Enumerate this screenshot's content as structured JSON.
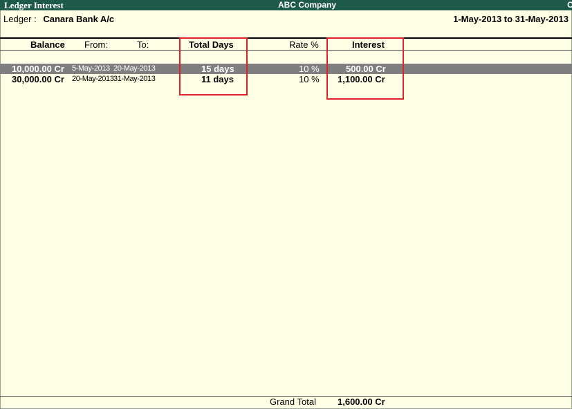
{
  "window": {
    "report_title": "Ledger Interest",
    "company": "ABC Company",
    "right_fragment": "C"
  },
  "ledger": {
    "label": "Ledger :",
    "name": "Canara Bank A/c",
    "period": "1-May-2013 to 31-May-2013"
  },
  "columns": {
    "balance": "Balance",
    "from": "From:",
    "to": "To:",
    "total_days": "Total Days",
    "rate": "Rate %",
    "interest": "Interest"
  },
  "rows": [
    {
      "balance": "10,000.00 Cr",
      "from": "5-May-2013",
      "to": "20-May-2013",
      "days": "15 days",
      "rate": "10 %",
      "interest": "500.00 Cr",
      "selected": true
    },
    {
      "balance": "30,000.00 Cr",
      "from": "20-May-2013",
      "to": "31-May-2013",
      "days": "11 days",
      "rate": "10 %",
      "interest": "1,100.00 Cr",
      "selected": false
    }
  ],
  "footer": {
    "grand_total_label": "Grand Total",
    "grand_total_value": "1,600.00 Cr"
  },
  "colors": {
    "title_bar": "#1e5a4a",
    "background": "#ffffe5",
    "selected_row": "#7f7f7f",
    "highlight_box": "#e0202a"
  }
}
